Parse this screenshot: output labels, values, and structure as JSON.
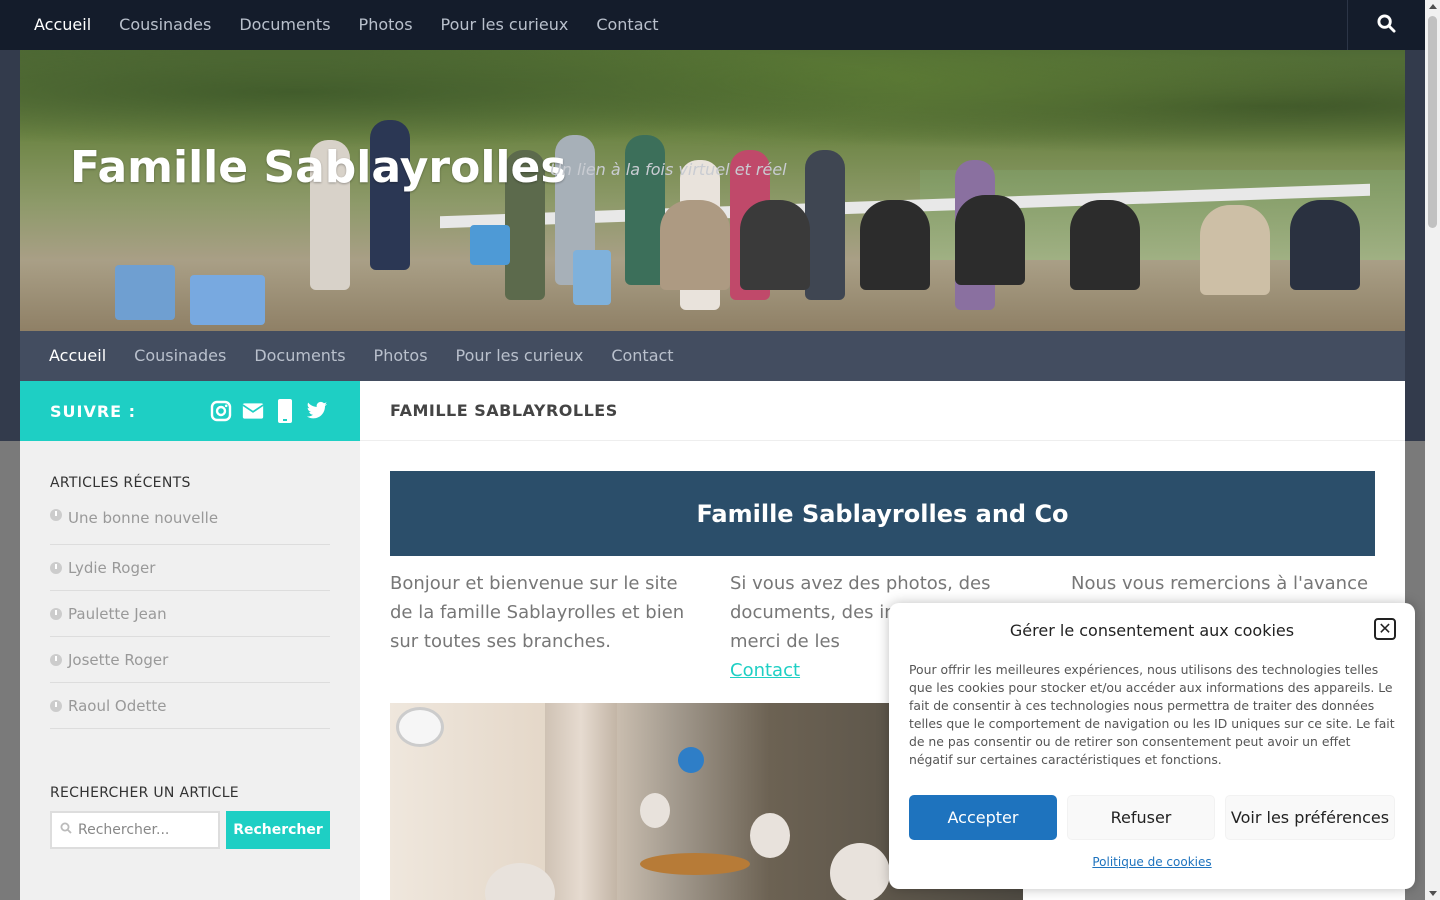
{
  "top_nav": {
    "items": [
      "Accueil",
      "Cousinades",
      "Documents",
      "Photos",
      "Pour les curieux",
      "Contact"
    ],
    "search_icon": "search-icon"
  },
  "header": {
    "title": "Famille Sablayrolles",
    "tagline": "Un lien à la fois virtuel et réel"
  },
  "sub_nav": {
    "items": [
      "Accueil",
      "Cousinades",
      "Documents",
      "Photos",
      "Pour les curieux",
      "Contact"
    ]
  },
  "sidebar": {
    "follow_label": "SUIVRE :",
    "social_icons": [
      "instagram-icon",
      "email-icon",
      "phone-icon",
      "twitter-icon"
    ],
    "recent_title": "ARTICLES RÉCENTS",
    "recent_items": [
      "Une bonne nouvelle",
      "Lydie Roger",
      "Paulette Jean",
      "Josette Roger",
      "Raoul Odette"
    ],
    "search_title": "RECHERCHER UN ARTICLE",
    "search_placeholder": "Rechercher...",
    "search_button": "Rechercher"
  },
  "main": {
    "page_heading": "FAMILLE SABLAYROLLES",
    "banner": "Famille Sablayrolles and Co",
    "col1": "Bonjour et bienvenue sur le site de la famille Sablayrolles et bien sur toutes ses branches.",
    "col2_text": "Si vous avez des photos, des documents, des in… idées merci de les",
    "col2_link": "Contact",
    "col3": "Nous vous remercions à l'avance"
  },
  "cookie": {
    "title": "Gérer le consentement aux cookies",
    "body": "Pour offrir les meilleures expériences, nous utilisons des technologies telles que les cookies pour stocker et/ou accéder aux informations des appareils. Le fait de consentir à ces technologies nous permettra de traiter des données telles que le comportement de navigation ou les ID uniques sur ce site. Le fait de ne pas consentir ou de retirer son consentement peut avoir un effet négatif sur certaines caractéristiques et fonctions.",
    "accept": "Accepter",
    "refuse": "Refuser",
    "prefs": "Voir les préférences",
    "policy": "Politique de cookies",
    "colors": {
      "accept_bg": "#1e73be",
      "accent": "#1ecfc4",
      "banner_bg": "#2b4e6a"
    }
  }
}
